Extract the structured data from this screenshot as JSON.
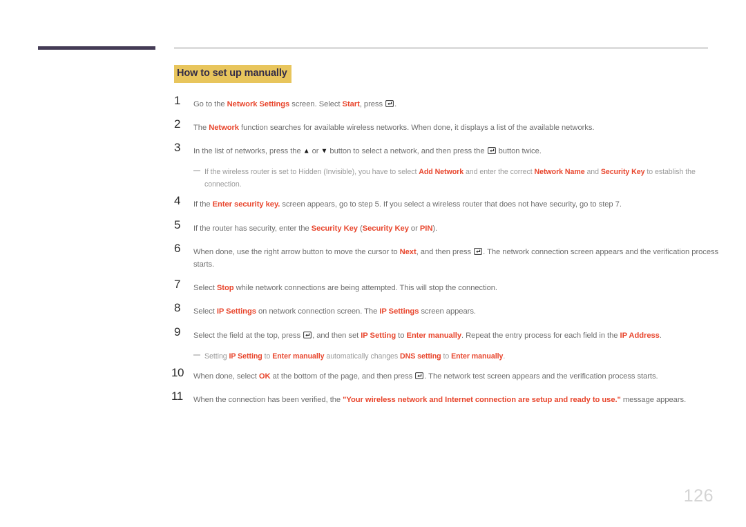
{
  "page": {
    "number": "126",
    "heading": "How to set up manually"
  },
  "icons": {
    "enter_key": "enter-key-icon",
    "up_arrow": "▲",
    "down_arrow": "▼"
  },
  "colors": {
    "heading_highlight": "#e8c55c",
    "heading_text": "#332c47",
    "accent_term": "#e8452c",
    "body_text": "#6d6d6d",
    "note_text": "#9a9a9a",
    "rule": "#848484",
    "left_bar": "#443b55",
    "page_number": "#d4d4d4"
  },
  "steps": [
    {
      "num": "1",
      "html": "Go to the <b>Network Settings</b> screen. Select <b>Start</b>, press <span class=\"enter-icon\" data-name=\"enter-key-icon\" data-interactable=\"false\"><svg width=\"12\" height=\"10\" viewBox=\"0 0 12 10\"><rect x=\"0.5\" y=\"0.5\" width=\"11\" height=\"9\" rx=\"1.5\" fill=\"none\" stroke=\"#4a4a4a\" stroke-width=\"1.2\"/><path d=\"M8.6 2.6 V5.4 H4.6\" fill=\"none\" stroke=\"#2b2b2b\" stroke-width=\"1.2\"/><path d=\"M5.4 3.5 L3.2 5.4 L5.4 7.3 Z\" fill=\"#2b2b2b\"/></svg></span>."
    },
    {
      "num": "2",
      "html": "The <b>Network</b> function searches for available wireless networks. When done, it displays a list of the available networks."
    },
    {
      "num": "3",
      "html": "In the list of networks, press the <span class=\"arrow-glyph\" data-name=\"up-arrow-icon\" data-interactable=\"false\">▲</span> or <span class=\"arrow-glyph\" data-name=\"down-arrow-icon\" data-interactable=\"false\">▼</span> button to select a network, and then press the <span class=\"enter-icon\" data-name=\"enter-key-icon\" data-interactable=\"false\"><svg width=\"12\" height=\"10\" viewBox=\"0 0 12 10\"><rect x=\"0.5\" y=\"0.5\" width=\"11\" height=\"9\" rx=\"1.5\" fill=\"none\" stroke=\"#4a4a4a\" stroke-width=\"1.2\"/><path d=\"M8.6 2.6 V5.4 H4.6\" fill=\"none\" stroke=\"#2b2b2b\" stroke-width=\"1.2\"/><path d=\"M5.4 3.5 L3.2 5.4 L5.4 7.3 Z\" fill=\"#2b2b2b\"/></svg></span> button twice."
    },
    {
      "num": "4",
      "html": "If the <b>Enter security key.</b> screen appears, go to step 5. If you select a wireless router that does not have security, go to step 7."
    },
    {
      "num": "5",
      "html": "If the router has security, enter the <b>Security Key</b> (<b>Security Key</b> or <b>PIN</b>)."
    },
    {
      "num": "6",
      "html": "When done, use the right arrow button to move the cursor to <b>Next</b>, and then press <span class=\"enter-icon\" data-name=\"enter-key-icon\" data-interactable=\"false\"><svg width=\"12\" height=\"10\" viewBox=\"0 0 12 10\"><rect x=\"0.5\" y=\"0.5\" width=\"11\" height=\"9\" rx=\"1.5\" fill=\"none\" stroke=\"#4a4a4a\" stroke-width=\"1.2\"/><path d=\"M8.6 2.6 V5.4 H4.6\" fill=\"none\" stroke=\"#2b2b2b\" stroke-width=\"1.2\"/><path d=\"M5.4 3.5 L3.2 5.4 L5.4 7.3 Z\" fill=\"#2b2b2b\"/></svg></span>. The network connection screen appears and the verification process starts."
    },
    {
      "num": "7",
      "html": "Select <b>Stop</b> while network connections are being attempted. This will stop the connection."
    },
    {
      "num": "8",
      "html": "Select <b>IP Settings</b> on network connection screen. The <b>IP Settings</b> screen appears."
    },
    {
      "num": "9",
      "html": "Select the field at the top, press <span class=\"enter-icon\" data-name=\"enter-key-icon\" data-interactable=\"false\"><svg width=\"12\" height=\"10\" viewBox=\"0 0 12 10\"><rect x=\"0.5\" y=\"0.5\" width=\"11\" height=\"9\" rx=\"1.5\" fill=\"none\" stroke=\"#4a4a4a\" stroke-width=\"1.2\"/><path d=\"M8.6 2.6 V5.4 H4.6\" fill=\"none\" stroke=\"#2b2b2b\" stroke-width=\"1.2\"/><path d=\"M5.4 3.5 L3.2 5.4 L5.4 7.3 Z\" fill=\"#2b2b2b\"/></svg></span>, and then set <b>IP Setting</b> to <b>Enter manually</b>. Repeat the entry process for each field in the <b>IP Address</b>."
    },
    {
      "num": "10",
      "html": "When done, select <b>OK</b> at the bottom of the page, and then press <span class=\"enter-icon\" data-name=\"enter-key-icon\" data-interactable=\"false\"><svg width=\"12\" height=\"10\" viewBox=\"0 0 12 10\"><rect x=\"0.5\" y=\"0.5\" width=\"11\" height=\"9\" rx=\"1.5\" fill=\"none\" stroke=\"#4a4a4a\" stroke-width=\"1.2\"/><path d=\"M8.6 2.6 V5.4 H4.6\" fill=\"none\" stroke=\"#2b2b2b\" stroke-width=\"1.2\"/><path d=\"M5.4 3.5 L3.2 5.4 L5.4 7.3 Z\" fill=\"#2b2b2b\"/></svg></span>. The network test screen appears and the verification process starts."
    },
    {
      "num": "11",
      "html": "When the connection has been verified, the <b>\"Your wireless network and Internet connection are setup and ready to use.\"</b> message appears."
    }
  ],
  "notes": {
    "after_step_3": "If the wireless router is set to Hidden (Invisible), you have to select <b>Add Network</b> and enter the correct <b>Network Name</b> and <b>Security Key</b> to establish the connection.",
    "after_step_9": "Setting <b>IP Setting</b> to <b>Enter manually</b> automatically changes <b>DNS setting</b> to <b>Enter manually</b>."
  }
}
